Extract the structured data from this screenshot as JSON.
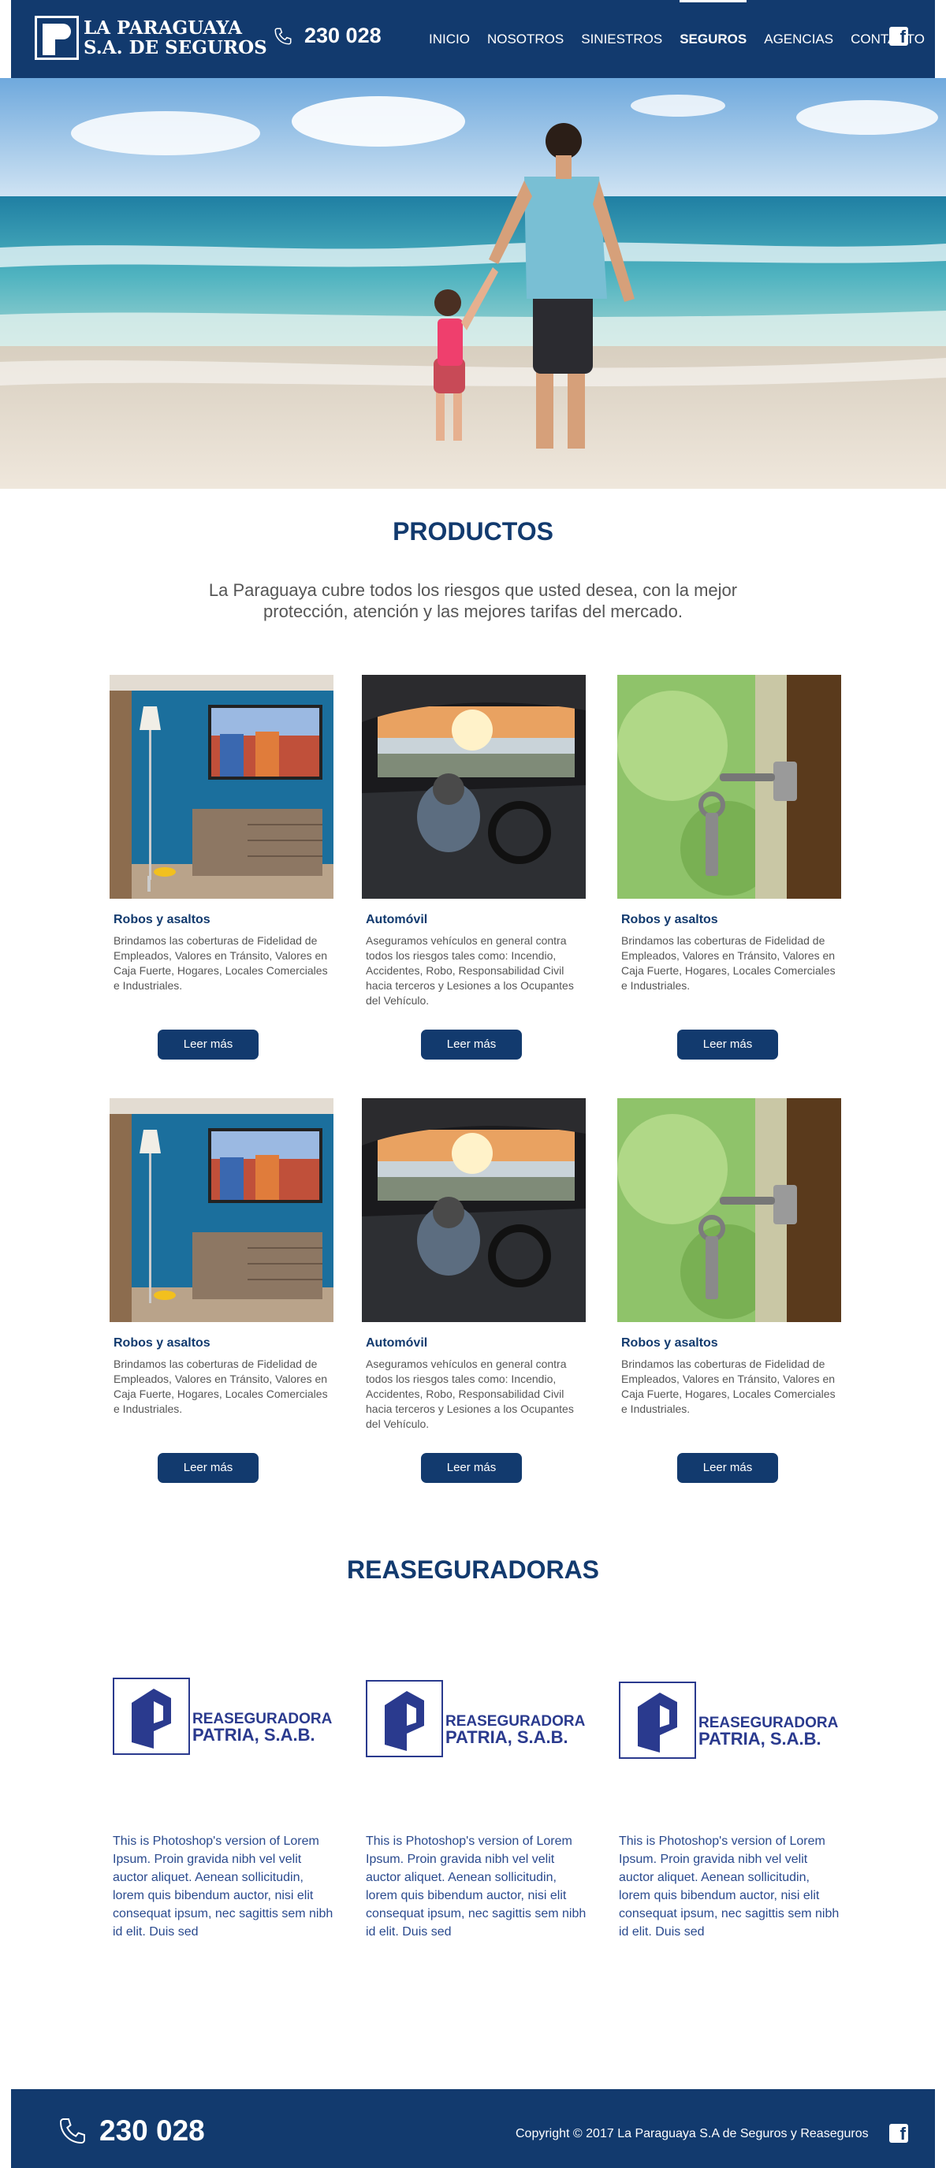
{
  "header": {
    "logo": {
      "line1": "LA PARAGUAYA",
      "line2": "S.A. DE SEGUROS",
      "icon": "la-paraguaya-logo"
    },
    "phone": {
      "icon": "phone-icon",
      "number": "230 028"
    },
    "nav": [
      {
        "label": "INICIO",
        "active": false
      },
      {
        "label": "NOSOTROS",
        "active": false
      },
      {
        "label": "SINIESTROS",
        "active": false
      },
      {
        "label": "SEGUROS",
        "active": true
      },
      {
        "label": "AGENCIAS",
        "active": false
      },
      {
        "label": "CONTACTO",
        "active": false
      }
    ],
    "social_icon": "facebook-icon"
  },
  "hero": {
    "image": "beach-father-daughter-photo"
  },
  "productos": {
    "title": "PRODUCTOS",
    "intro": "La Paraguaya cubre todos los riesgos que usted desea, con la mejor protección, atención y las mejores tarifas del mercado.",
    "cards": [
      {
        "title": "Robos y asaltos",
        "desc": "Brindamos las coberturas de Fidelidad de Empleados, Valores en Tránsito, Valores en Caja Fuerte, Hogares, Locales Comerciales e Industriales.",
        "button": "Leer más",
        "image": "living-room-photo"
      },
      {
        "title": "Automóvil",
        "desc": "Aseguramos vehículos en general contra todos los riesgos tales como: Incendio, Accidentes, Robo, Responsabilidad Civil hacia terceros y Lesiones a los Ocupantes del Vehículo.",
        "button": "Leer más",
        "image": "car-driver-photo"
      },
      {
        "title": "Robos y  asaltos",
        "desc": "Brindamos las coberturas de Fidelidad de Empleados, Valores en Tránsito, Valores en Caja Fuerte, Hogares, Locales Comerciales e Industriales.",
        "button": "Leer más",
        "image": "door-key-photo"
      },
      {
        "title": "Robos y asaltos",
        "desc": "Brindamos las coberturas de Fidelidad de Empleados, Valores en Tránsito, Valores en Caja Fuerte, Hogares, Locales Comerciales e Industriales.",
        "button": "Leer más",
        "image": "living-room-photo"
      },
      {
        "title": "Automóvil",
        "desc": "Aseguramos vehículos en general contra todos los riesgos tales como: Incendio, Accidentes, Robo, Responsabilidad Civil hacia terceros y Lesiones a los Ocupantes del Vehículo.",
        "button": "Leer más",
        "image": "car-driver-photo"
      },
      {
        "title": "Robos y  asaltos",
        "desc": "Brindamos las coberturas de Fidelidad de Empleados, Valores en Tránsito, Valores en Caja Fuerte, Hogares, Locales Comerciales e Industriales.",
        "button": "Leer más",
        "image": "door-key-photo"
      }
    ]
  },
  "reaseguradoras": {
    "title": "REASEGURADORAS",
    "cards": [
      {
        "logo_line1": "REASEGURADORA",
        "logo_line2": "PATRIA, S.A.B.",
        "desc": "This is Photoshop's version  of Lorem Ipsum. Proin gravida nibh vel velit auctor aliquet. Aenean sollicitudin, lorem quis bibendum auctor, nisi elit consequat ipsum, nec sagittis sem nibh id elit. Duis sed"
      },
      {
        "logo_line1": "REASEGURADORA",
        "logo_line2": "PATRIA, S.A.B.",
        "desc": "This is Photoshop's version  of Lorem Ipsum. Proin gravida nibh vel velit auctor aliquet. Aenean sollicitudin, lorem quis bibendum auctor, nisi elit consequat ipsum, nec sagittis sem nibh id elit. Duis sed"
      },
      {
        "logo_line1": "REASEGURADORA",
        "logo_line2": "PATRIA, S.A.B.",
        "desc": "This is Photoshop's version  of Lorem Ipsum. Proin gravida nibh vel velit auctor aliquet. Aenean sollicitudin, lorem quis bibendum auctor, nisi elit consequat ipsum, nec sagittis sem nibh id elit. Duis sed"
      }
    ]
  },
  "footer": {
    "phone": {
      "icon": "phone-icon",
      "number": "230 028"
    },
    "copyright": "Copyright © 2017 La Paraguaya S.A de Seguros y Reaseguros",
    "social_icon": "facebook-icon"
  },
  "colors": {
    "primary": "#123a6e",
    "logo_blue": "#2a3a8e",
    "text_gray": "#555555"
  }
}
